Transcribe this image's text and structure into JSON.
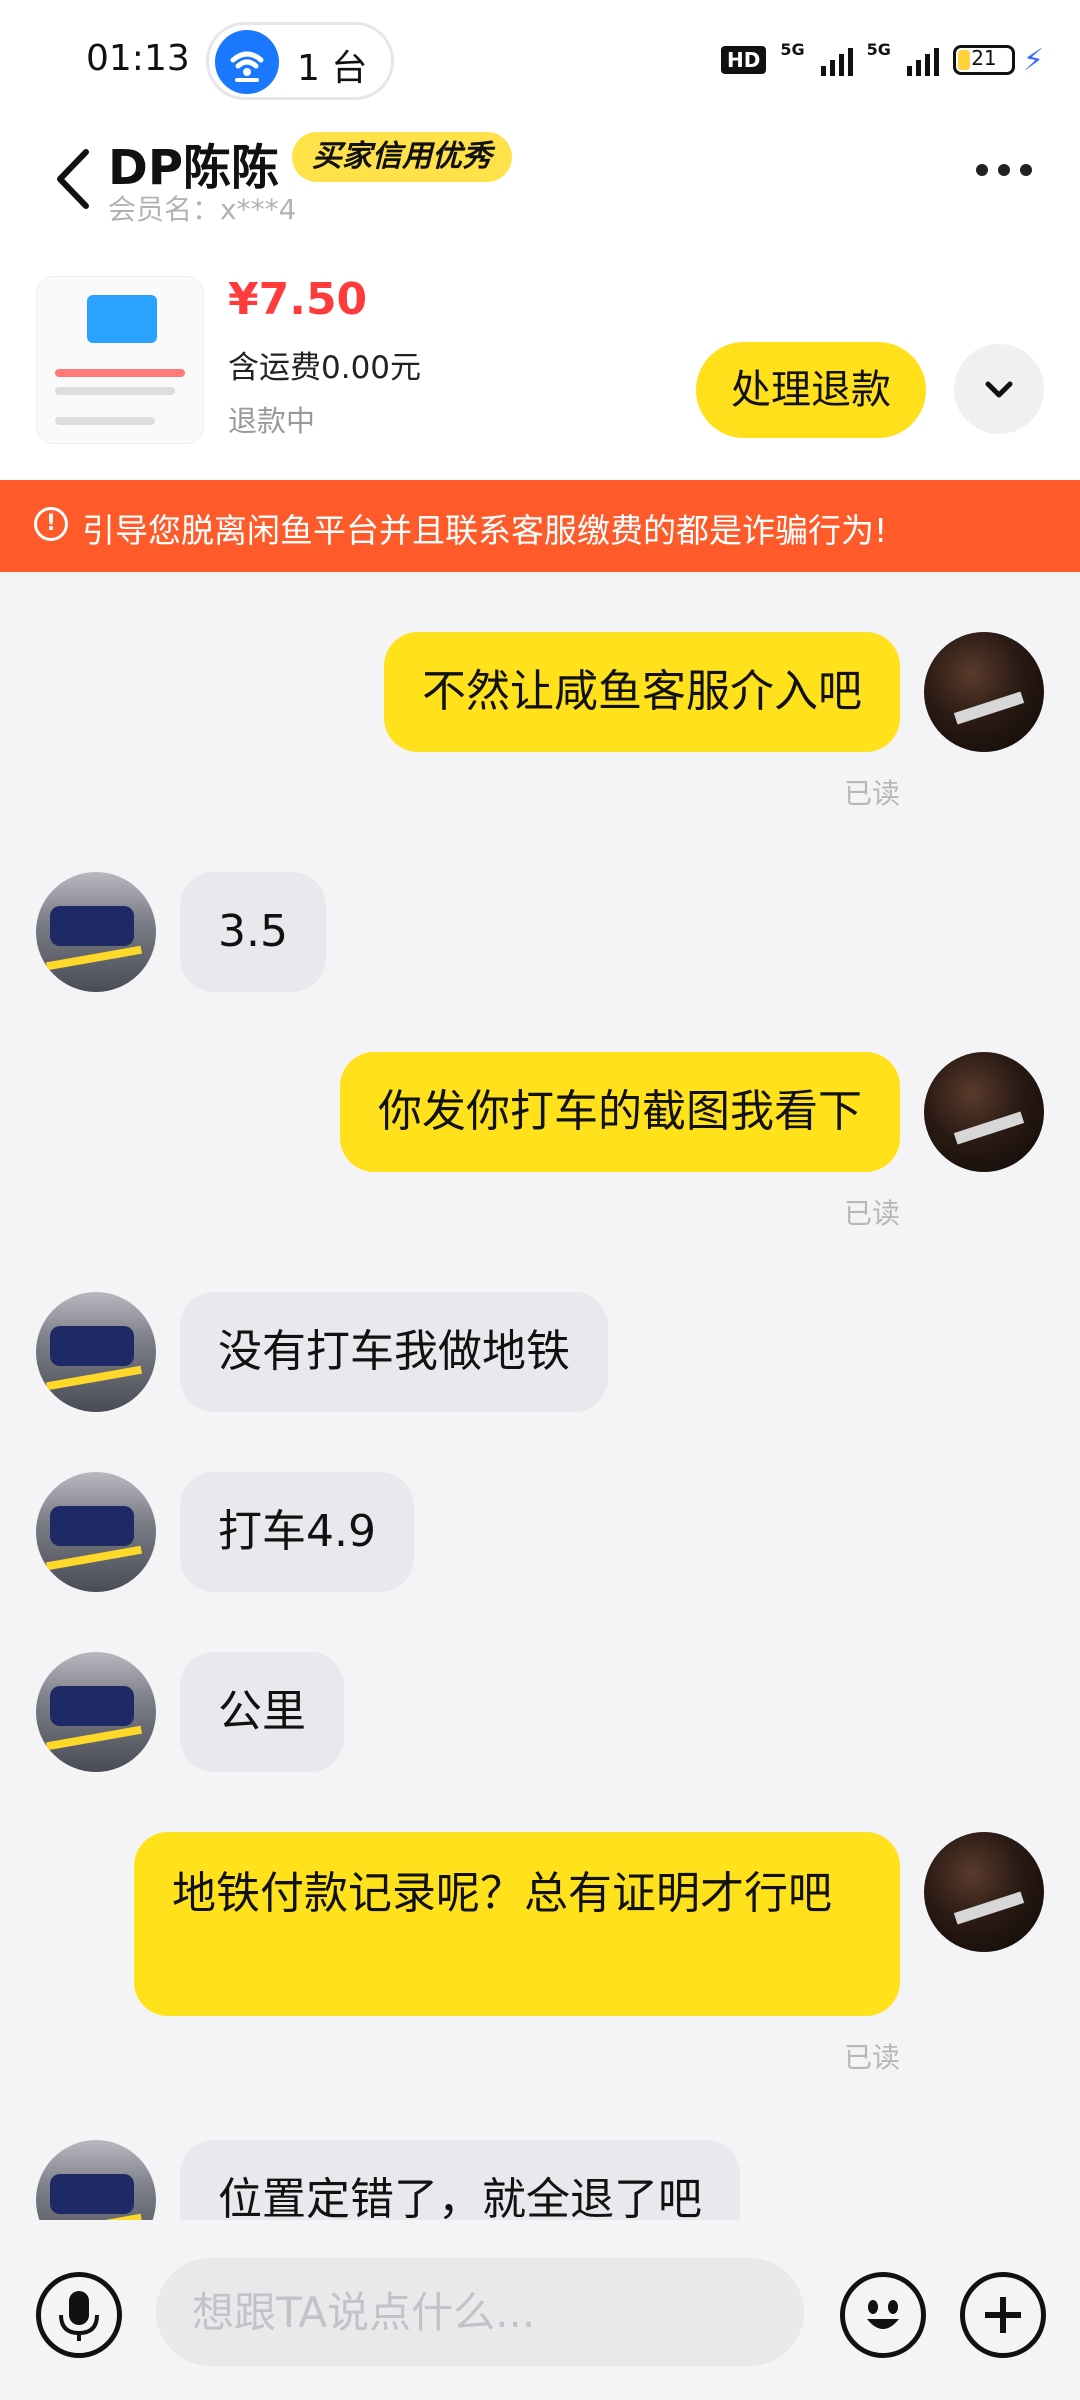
{
  "status_bar": {
    "time": "01:13",
    "hotspot_count": "1 台",
    "hd_badge": "HD",
    "network_1": "5G",
    "network_2": "5G",
    "battery_level": "21"
  },
  "header": {
    "title": "DP陈陈",
    "credit_badge": "买家信用优秀",
    "member_label": "会员名：",
    "member_id": "x***4"
  },
  "product": {
    "price": "¥7.50",
    "shipping": "含运费0.00元",
    "status": "退款中",
    "action_label": "处理退款"
  },
  "warning": {
    "text": "引导您脱离闲鱼平台并且联系客服缴费的都是诈骗行为!",
    "icon": "exclamation-icon"
  },
  "messages": [
    {
      "side": "me",
      "text": "不然让咸鱼客服介入吧",
      "read": "已读"
    },
    {
      "side": "other",
      "text": "3.5"
    },
    {
      "side": "me",
      "text": "你发你打车的截图我看下",
      "read": "已读"
    },
    {
      "side": "other",
      "text": "没有打车我做地铁"
    },
    {
      "side": "other",
      "text": "打车4.9"
    },
    {
      "side": "other",
      "text": "公里"
    },
    {
      "side": "me",
      "text": "地铁付款记录呢？总有证明才行吧",
      "read": "已读"
    },
    {
      "side": "other",
      "text": "位置定错了，就全退了吧"
    }
  ],
  "input": {
    "placeholder": "想跟TA说点什么..."
  },
  "colors": {
    "accent_yellow": "#ffe21b",
    "warning_orange": "#ff5a2a",
    "price_red": "#ff3b3b"
  }
}
